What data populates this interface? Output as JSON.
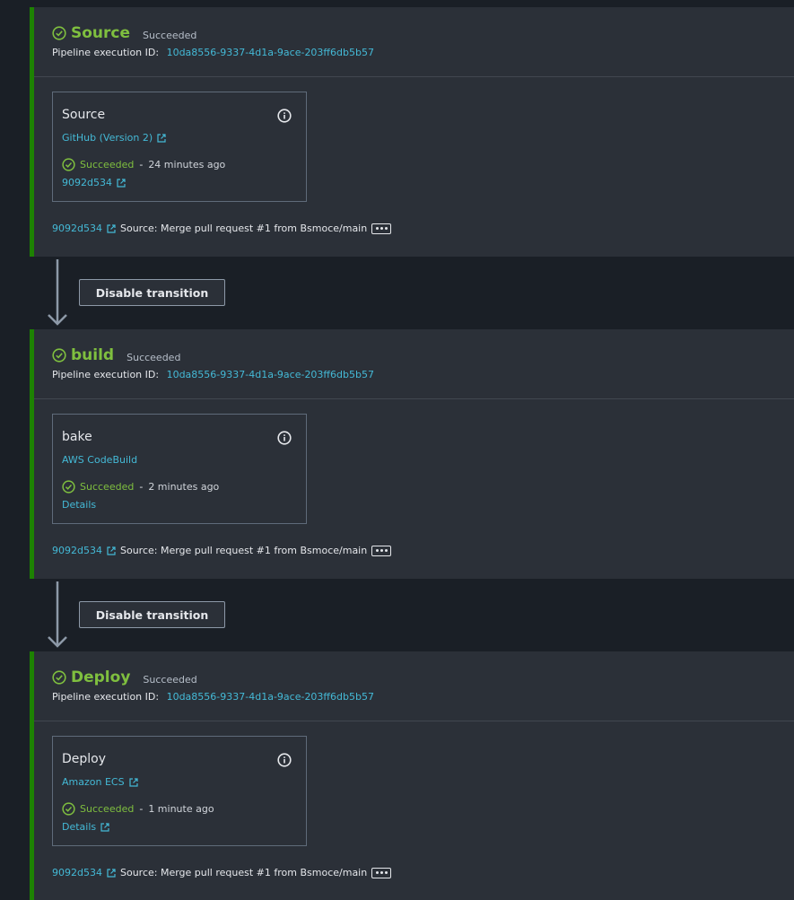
{
  "exec_label": "Pipeline execution ID:",
  "stages": [
    {
      "name": "Source",
      "status": "Succeeded",
      "execution_id": "10da8556-9337-4d1a-9ace-203ff6db5b57",
      "action": {
        "name": "Source",
        "provider": "GitHub (Version 2)",
        "status": "Succeeded",
        "time_ago": "24 minutes ago",
        "detail": "9092d534"
      },
      "commit": {
        "id": "9092d534",
        "message": "Source: Merge pull request #1 from Bsmoce/main"
      }
    },
    {
      "name": "build",
      "status": "Succeeded",
      "execution_id": "10da8556-9337-4d1a-9ace-203ff6db5b57",
      "action": {
        "name": "bake",
        "provider": "AWS CodeBuild",
        "status": "Succeeded",
        "time_ago": "2 minutes ago",
        "detail": "Details"
      },
      "commit": {
        "id": "9092d534",
        "message": "Source: Merge pull request #1 from Bsmoce/main"
      }
    },
    {
      "name": "Deploy",
      "status": "Succeeded",
      "execution_id": "10da8556-9337-4d1a-9ace-203ff6db5b57",
      "action": {
        "name": "Deploy",
        "provider": "Amazon ECS",
        "status": "Succeeded",
        "time_ago": "1 minute ago",
        "detail": "Details"
      },
      "commit": {
        "id": "9092d534",
        "message": "Source: Merge pull request #1 from Bsmoce/main"
      }
    }
  ],
  "transitions": [
    {
      "button_label": "Disable transition"
    },
    {
      "button_label": "Disable transition"
    }
  ],
  "icons": {
    "success": "check-circle-icon",
    "info": "info-icon",
    "external": "external-link-icon",
    "more": "ellipsis-icon",
    "arrow": "arrow-down-icon"
  },
  "colors": {
    "success": "#7fbf3f",
    "link": "#44b9d6",
    "stage_border": "#1d8102",
    "background": "#1a1f26",
    "panel": "#2b3038"
  }
}
